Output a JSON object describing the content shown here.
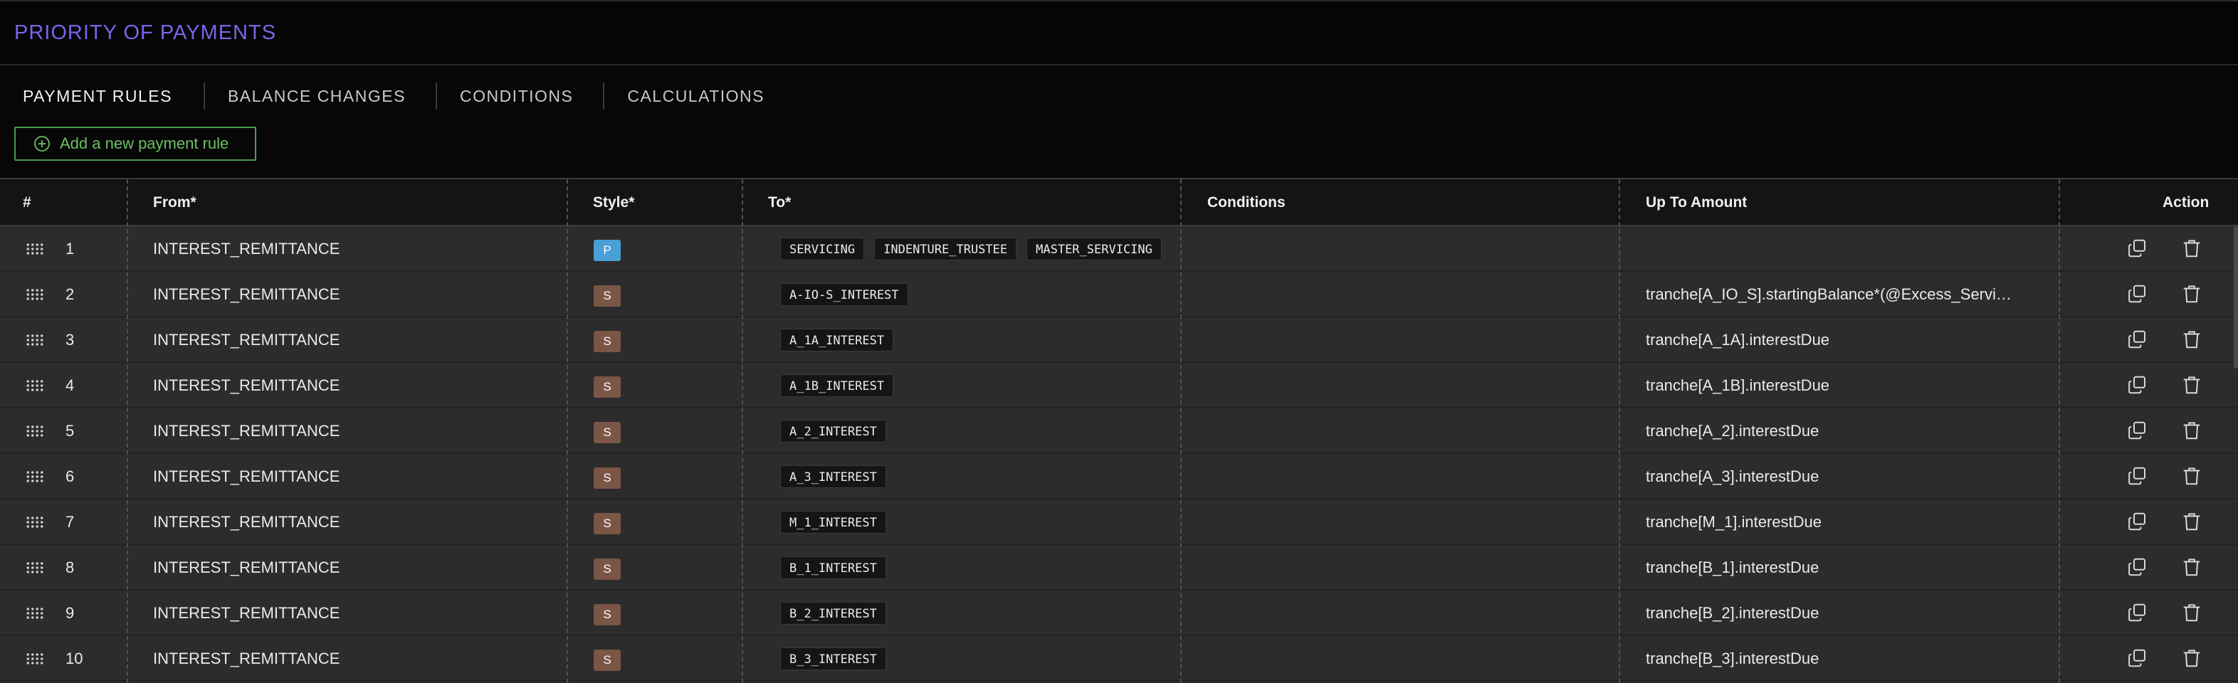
{
  "header": {
    "title": "PRIORITY OF PAYMENTS"
  },
  "tabs": [
    {
      "label": "PAYMENT RULES",
      "active": true
    },
    {
      "label": "BALANCE CHANGES",
      "active": false
    },
    {
      "label": "CONDITIONS",
      "active": false
    },
    {
      "label": "CALCULATIONS",
      "active": false
    }
  ],
  "add_button": {
    "label": "Add a new payment rule",
    "icon": "plus-circle-icon"
  },
  "table": {
    "columns": {
      "num": "#",
      "from": "From*",
      "style": "Style*",
      "to": "To*",
      "conditions": "Conditions",
      "up_to": "Up To Amount",
      "action": "Action"
    },
    "rows": [
      {
        "num": "1",
        "from": "INTEREST_REMITTANCE",
        "style": "P",
        "to": [
          "SERVICING",
          "INDENTURE_TRUSTEE",
          "MASTER_SERVICING"
        ],
        "conditions": "",
        "up_to": ""
      },
      {
        "num": "2",
        "from": "INTEREST_REMITTANCE",
        "style": "S",
        "to": [
          "A-IO-S_INTEREST"
        ],
        "conditions": "",
        "up_to": "tranche[A_IO_S].startingBalance*(@Excess_Servi…"
      },
      {
        "num": "3",
        "from": "INTEREST_REMITTANCE",
        "style": "S",
        "to": [
          "A_1A_INTEREST"
        ],
        "conditions": "",
        "up_to": "tranche[A_1A].interestDue"
      },
      {
        "num": "4",
        "from": "INTEREST_REMITTANCE",
        "style": "S",
        "to": [
          "A_1B_INTEREST"
        ],
        "conditions": "",
        "up_to": "tranche[A_1B].interestDue"
      },
      {
        "num": "5",
        "from": "INTEREST_REMITTANCE",
        "style": "S",
        "to": [
          "A_2_INTEREST"
        ],
        "conditions": "",
        "up_to": "tranche[A_2].interestDue"
      },
      {
        "num": "6",
        "from": "INTEREST_REMITTANCE",
        "style": "S",
        "to": [
          "A_3_INTEREST"
        ],
        "conditions": "",
        "up_to": "tranche[A_3].interestDue"
      },
      {
        "num": "7",
        "from": "INTEREST_REMITTANCE",
        "style": "S",
        "to": [
          "M_1_INTEREST"
        ],
        "conditions": "",
        "up_to": "tranche[M_1].interestDue"
      },
      {
        "num": "8",
        "from": "INTEREST_REMITTANCE",
        "style": "S",
        "to": [
          "B_1_INTEREST"
        ],
        "conditions": "",
        "up_to": "tranche[B_1].interestDue"
      },
      {
        "num": "9",
        "from": "INTEREST_REMITTANCE",
        "style": "S",
        "to": [
          "B_2_INTEREST"
        ],
        "conditions": "",
        "up_to": "tranche[B_2].interestDue"
      },
      {
        "num": "10",
        "from": "INTEREST_REMITTANCE",
        "style": "S",
        "to": [
          "B_3_INTEREST"
        ],
        "conditions": "",
        "up_to": "tranche[B_3].interestDue"
      }
    ],
    "row_icons": {
      "drag": "drag-handle-icon",
      "copy": "copy-icon",
      "delete": "trash-icon"
    }
  },
  "colors": {
    "title": "#7e63e6",
    "add_button": "#6cbf62",
    "style_p": "#4a9fd6",
    "style_s": "#7b5545"
  }
}
